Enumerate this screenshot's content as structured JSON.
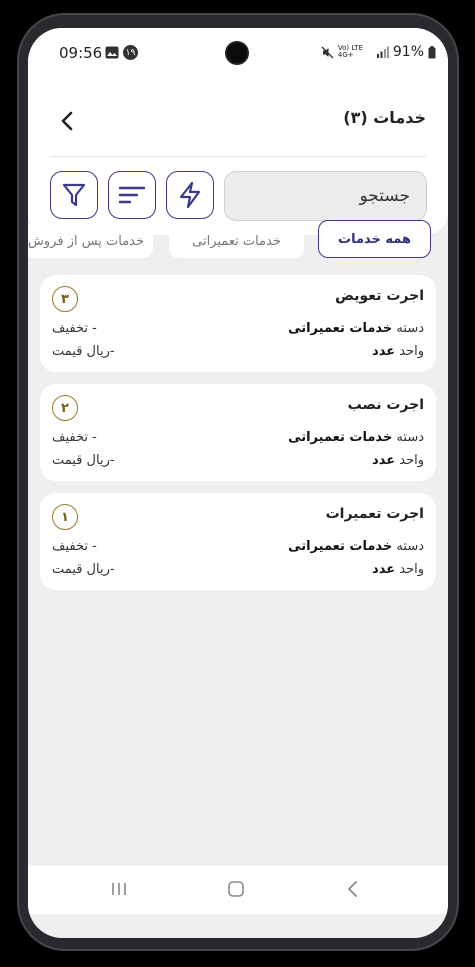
{
  "status_bar": {
    "time": "09:56",
    "notification_badge": "۱۹",
    "network": "Vo) LTE 4G+",
    "battery": "91%"
  },
  "header": {
    "title": "خدمات (۳)",
    "back_icon": "chevron-left-icon"
  },
  "search": {
    "placeholder": "جستجو"
  },
  "toolbar": {
    "buttons": [
      "lightning-icon",
      "sort-icon",
      "filter-icon"
    ]
  },
  "tabs": [
    {
      "label": "همه خدمات",
      "active": true
    },
    {
      "label": "خدمات تعمیراتی",
      "active": false
    },
    {
      "label": "خدمات پس از فروش",
      "active": false
    }
  ],
  "services": [
    {
      "title": "اجرت تعویض",
      "number": "۳",
      "category_label": "دسته",
      "category_value": "خدمات تعمیراتی",
      "unit_label": "واحد",
      "unit_value": "عدد",
      "discount": "- تخفیف",
      "price": "-ریال قیمت"
    },
    {
      "title": "اجرت نصب",
      "number": "۲",
      "category_label": "دسته",
      "category_value": "خدمات تعمیراتی",
      "unit_label": "واحد",
      "unit_value": "عدد",
      "discount": "- تخفیف",
      "price": "-ریال قیمت"
    },
    {
      "title": "اجرت تعمیرات",
      "number": "۱",
      "category_label": "دسته",
      "category_value": "خدمات تعمیراتی",
      "unit_label": "واحد",
      "unit_value": "عدد",
      "discount": "- تخفیف",
      "price": "-ریال قیمت"
    }
  ],
  "colors": {
    "accent": "#3a3a8c",
    "badge": "#9a7a2e"
  }
}
